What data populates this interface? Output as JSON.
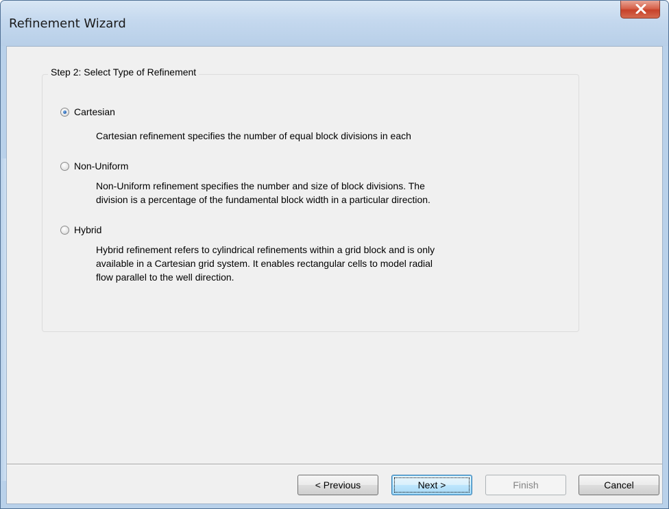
{
  "window": {
    "title": "Refinement Wizard",
    "close_icon": "close-x-icon"
  },
  "step": {
    "legend": "Step 2: Select Type of Refinement",
    "options": [
      {
        "label": "Cartesian",
        "checked": true,
        "description": "Cartesian refinement specifies the number of equal block divisions in each"
      },
      {
        "label": "Non-Uniform",
        "checked": false,
        "description": "Non-Uniform refinement specifies the number and size of block divisions.  The\ndivision is a percentage of the fundamental block width in a particular direction."
      },
      {
        "label": "Hybrid",
        "checked": false,
        "description": "Hybrid refinement refers to cylindrical refinements within a grid block and is only\navailable in a Cartesian grid system.  It enables rectangular cells to model radial\nflow parallel to the well direction."
      }
    ]
  },
  "buttons": {
    "previous": "< Previous",
    "next": "Next >",
    "finish": "Finish",
    "cancel": "Cancel"
  }
}
